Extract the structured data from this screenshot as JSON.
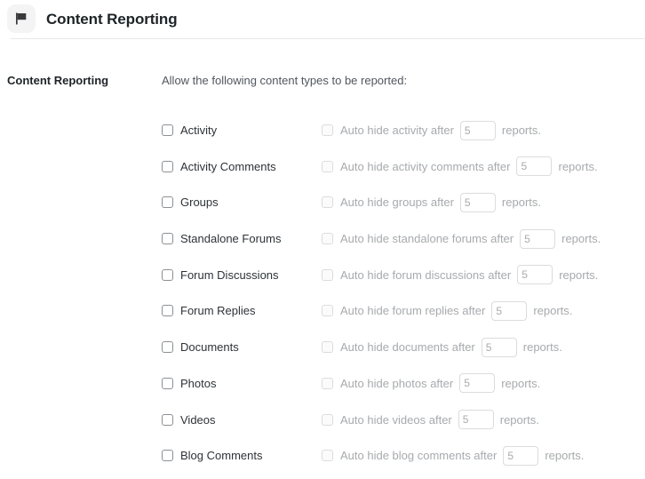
{
  "header": {
    "icon": "flag-icon",
    "title": "Content Reporting"
  },
  "section": {
    "label": "Content Reporting",
    "intro": "Allow the following content types to be reported:"
  },
  "common": {
    "auto_hide_prefix": "Auto hide",
    "auto_hide_suffix": "after",
    "reports_text": "reports.",
    "default_threshold": "5"
  },
  "colors": {
    "title": "#1d2327",
    "label": "#2c3338",
    "muted": "#a7aaad",
    "border": "#dcdcde",
    "divider": "#e8e8e9",
    "badge_bg": "#f4f4f5"
  },
  "rows": [
    {
      "id": "activity",
      "label": "Activity",
      "checked": false,
      "auto_hide_label": "Auto hide activity after",
      "auto_hide_checked": false,
      "auto_hide_disabled": true,
      "threshold": "5",
      "reports_text": "reports."
    },
    {
      "id": "activity-comments",
      "label": "Activity Comments",
      "checked": false,
      "auto_hide_label": "Auto hide activity comments after",
      "auto_hide_checked": false,
      "auto_hide_disabled": true,
      "threshold": "5",
      "reports_text": "reports."
    },
    {
      "id": "groups",
      "label": "Groups",
      "checked": false,
      "auto_hide_label": "Auto hide groups after",
      "auto_hide_checked": false,
      "auto_hide_disabled": true,
      "threshold": "5",
      "reports_text": "reports."
    },
    {
      "id": "standalone-forums",
      "label": "Standalone Forums",
      "checked": false,
      "auto_hide_label": "Auto hide standalone forums after",
      "auto_hide_checked": false,
      "auto_hide_disabled": true,
      "threshold": "5",
      "reports_text": "reports."
    },
    {
      "id": "forum-discussions",
      "label": "Forum Discussions",
      "checked": false,
      "auto_hide_label": "Auto hide forum discussions after",
      "auto_hide_checked": false,
      "auto_hide_disabled": true,
      "threshold": "5",
      "reports_text": "reports."
    },
    {
      "id": "forum-replies",
      "label": "Forum Replies",
      "checked": false,
      "auto_hide_label": "Auto hide forum replies after",
      "auto_hide_checked": false,
      "auto_hide_disabled": true,
      "threshold": "5",
      "reports_text": "reports."
    },
    {
      "id": "documents",
      "label": "Documents",
      "checked": false,
      "auto_hide_label": "Auto hide documents after",
      "auto_hide_checked": false,
      "auto_hide_disabled": true,
      "threshold": "5",
      "reports_text": "reports."
    },
    {
      "id": "photos",
      "label": "Photos",
      "checked": false,
      "auto_hide_label": "Auto hide photos after",
      "auto_hide_checked": false,
      "auto_hide_disabled": true,
      "threshold": "5",
      "reports_text": "reports."
    },
    {
      "id": "videos",
      "label": "Videos",
      "checked": false,
      "auto_hide_label": "Auto hide videos after",
      "auto_hide_checked": false,
      "auto_hide_disabled": true,
      "threshold": "5",
      "reports_text": "reports."
    },
    {
      "id": "blog-comments",
      "label": "Blog Comments",
      "checked": false,
      "auto_hide_label": "Auto hide blog comments after",
      "auto_hide_checked": false,
      "auto_hide_disabled": true,
      "threshold": "5",
      "reports_text": "reports."
    }
  ]
}
